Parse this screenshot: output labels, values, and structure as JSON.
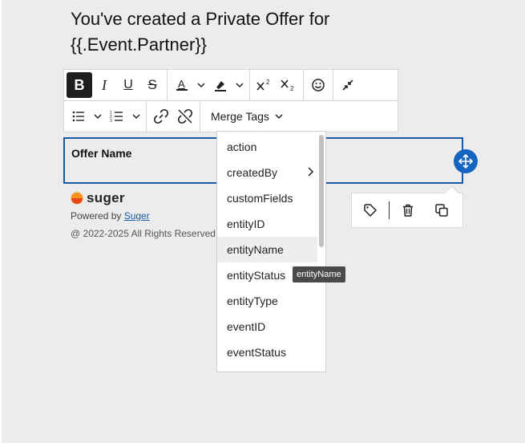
{
  "email": {
    "heading": "You've created a Private Offer for {{.Event.Partner}}",
    "block_label": "Offer Name"
  },
  "toolbar": {
    "merge_tags_label": "Merge Tags"
  },
  "merge_menu": {
    "items": [
      {
        "label": "action"
      },
      {
        "label": "createdBy",
        "has_submenu": true
      },
      {
        "label": "customFields"
      },
      {
        "label": "entityID"
      },
      {
        "label": "entityName",
        "hovered": true
      },
      {
        "label": "entityStatus"
      },
      {
        "label": "entityType"
      },
      {
        "label": "eventID"
      },
      {
        "label": "eventStatus"
      }
    ],
    "tooltip": "entityName"
  },
  "footer": {
    "brand": "suger",
    "powered_prefix": "Powered by ",
    "powered_link": "Suger",
    "rights": "@ 2022-2025 All Rights Reserved"
  },
  "colors": {
    "accent": "#1565c0",
    "selection_border": "#1a5aa5",
    "canvas_bg": "#ececec",
    "logo_orange": "#f7941d"
  }
}
